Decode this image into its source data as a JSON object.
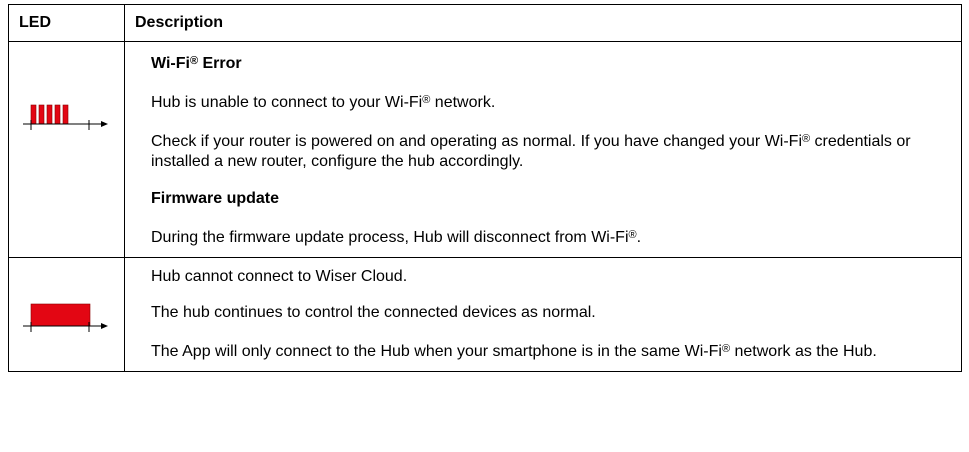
{
  "header": {
    "led": "LED",
    "description": "Description"
  },
  "colors": {
    "led_red": "#e30613",
    "border": "#000000"
  },
  "rows": [
    {
      "led_icon": "led-blinking-red-icon",
      "items": [
        {
          "kind": "heading",
          "text": "Wi-Fi® Error"
        },
        {
          "kind": "para",
          "text": "Hub is unable to connect to your Wi-Fi® network."
        },
        {
          "kind": "para",
          "text": "Check if your router is powered on and operating as normal. If you have changed your Wi-Fi® credentials or installed a new router, configure the hub accordingly."
        },
        {
          "kind": "heading",
          "text": "Firmware update"
        },
        {
          "kind": "para",
          "text": "During the firmware update process, Hub will disconnect from Wi-Fi®."
        }
      ]
    },
    {
      "led_icon": "led-steady-red-icon",
      "items": [
        {
          "kind": "para",
          "text": "Hub cannot connect to Wiser Cloud."
        },
        {
          "kind": "para",
          "text": "The hub continues to control the connected devices as normal."
        },
        {
          "kind": "para",
          "text": "The App will only connect to the Hub when your smartphone is in the same Wi-Fi® network as the Hub."
        }
      ]
    }
  ]
}
